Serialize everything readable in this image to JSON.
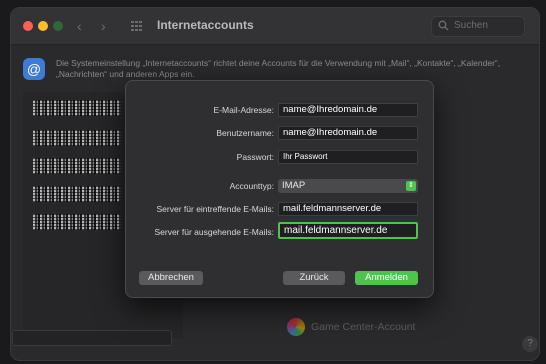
{
  "window": {
    "title": "Internetaccounts"
  },
  "search": {
    "placeholder": "Suchen"
  },
  "info": {
    "text": "Die Systemeinstellung „Internetaccounts“ richtet deine Accounts für die Verwendung mit „Mail“, „Kontakte“, „Kalender“, „Nachrichten“ und anderen Apps ein."
  },
  "background": {
    "game_center_label": "Game Center-Account"
  },
  "form": {
    "email_label": "E-Mail-Adresse:",
    "email_value": "name@Ihredomain.de",
    "username_label": "Benutzername:",
    "username_value": "name@Ihredomain.de",
    "password_label": "Passwort:",
    "password_value": "Ihr Passwort",
    "accounttype_label": "Accounttyp:",
    "accounttype_value": "IMAP",
    "incoming_label": "Server für eintreffende E-Mails:",
    "incoming_value": "mail.feldmannserver.de",
    "outgoing_label": "Server für ausgehende E-Mails:",
    "outgoing_value": "mail.feldmannserver.de"
  },
  "buttons": {
    "cancel": "Abbrechen",
    "back": "Zurück",
    "submit": "Anmelden"
  },
  "colors": {
    "accent_green": "#4ec34f",
    "brand_blue": "#3d7bd6"
  }
}
